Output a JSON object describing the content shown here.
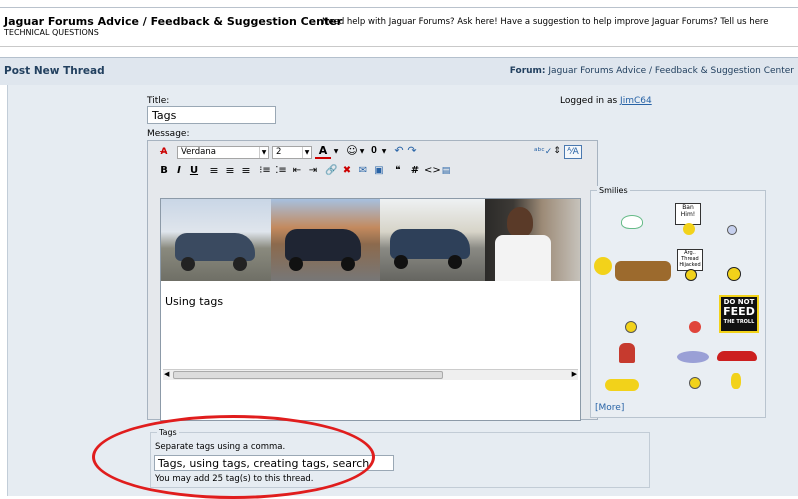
{
  "forum_header": {
    "title": "Jaguar Forums Advice / Feedback & Suggestion Center",
    "description": "Need help with Jaguar Forums? Ask here! Have a suggestion to help improve Jaguar Forums? Tell us here",
    "subtitle": "TECHNICAL QUESTIONS"
  },
  "section_header": {
    "title": "Post New Thread",
    "forum_prefix": "Forum:",
    "forum_name": "Jaguar Forums Advice / Feedback & Suggestion Center"
  },
  "form": {
    "title_label": "Title:",
    "title_value": "Tags",
    "logged_in_prefix": "Logged in as",
    "username": "JimC64",
    "message_label": "Message:"
  },
  "editor": {
    "font_name": "Verdana",
    "font_size": "2",
    "body_text": "Using tags",
    "toolbar_row2": [
      "B",
      "I",
      "U"
    ]
  },
  "smilies": {
    "legend": "Smilies",
    "more_link": "[More]",
    "sign_ban": "Ban Him!",
    "sign_arg": "Arg.. Thread Hijacked",
    "sign_feed_1": "DO NOT",
    "sign_feed_2": "FEED",
    "sign_feed_3": "THE TROLL"
  },
  "tags": {
    "legend": "Tags",
    "hint": "Separate tags using a comma.",
    "value": "Tags, using tags, creating tags, search",
    "remaining": "You may add 25 tag(s) to this thread."
  },
  "colors": {
    "annotation": "#e01d1d",
    "link": "#2863a6",
    "header_band": "#dfe6ee"
  }
}
